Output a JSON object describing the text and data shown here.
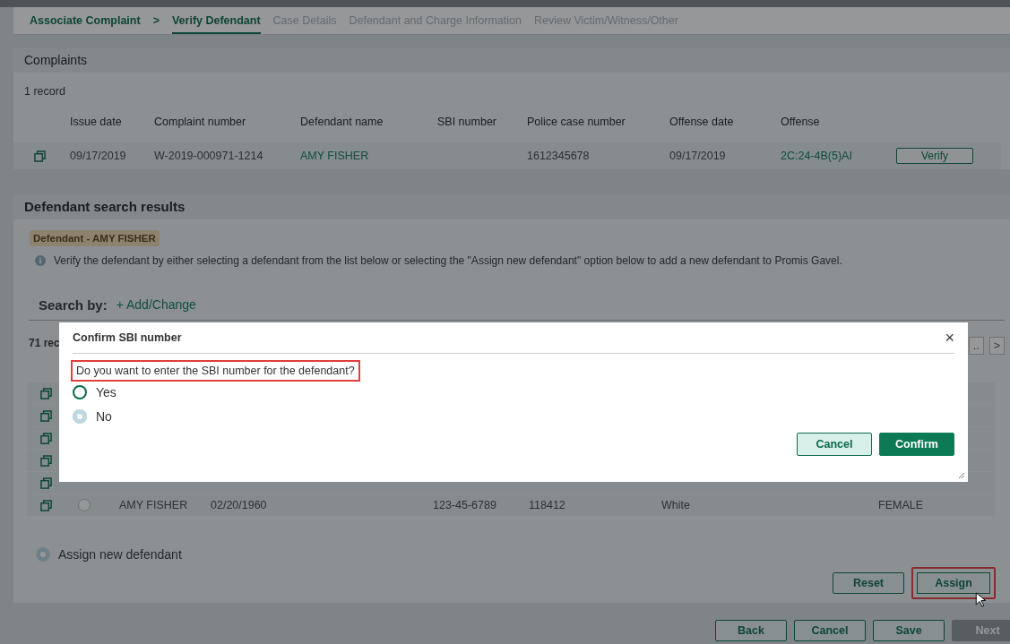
{
  "tabs": [
    {
      "label": "Associate Complaint",
      "selected": false,
      "enabled": true
    },
    {
      "label": "Verify Defendant",
      "selected": true,
      "enabled": true
    },
    {
      "label": "Case Details",
      "selected": false,
      "enabled": false
    },
    {
      "label": "Defendant and Charge Information",
      "selected": false,
      "enabled": false
    },
    {
      "label": "Review Victim/Witness/Other",
      "selected": false,
      "enabled": false
    }
  ],
  "tab_separator": ">",
  "complaints": {
    "title": "Complaints",
    "record_count": "1 record",
    "columns": [
      "Issue date",
      "Complaint number",
      "Defendant name",
      "SBI number",
      "Police case number",
      "Offense date",
      "Offense"
    ],
    "rows": [
      {
        "cells": [
          "09/17/2019",
          "W-2019-000971-1214",
          "AMY FISHER",
          "",
          "1612345678",
          "09/17/2019",
          "2C:24-4B(5)AI"
        ],
        "action": "Verify"
      }
    ]
  },
  "defendant_search": {
    "title": "Defendant search results",
    "defendant_tag": "Defendant - AMY FISHER",
    "info": "Verify the defendant by either selecting a defendant from the list below or selecting the \"Assign new defendant\" option below to add a new defendant to Promis Gavel.",
    "search_by_label": "Search by:",
    "add_change": "+ Add/Change",
    "record_count": "71 rec",
    "pager": [
      "..",
      ">"
    ],
    "rows": [
      {
        "selected": false,
        "cells": [
          "AMY FISHER",
          "02/20/1960",
          "123-45-6789",
          "118412",
          "White",
          "FEMALE"
        ]
      }
    ],
    "assign_new": {
      "label": "Assign new defendant",
      "selected": true
    },
    "buttons": [
      {
        "label": "Reset",
        "highlighted": false
      },
      {
        "label": "Assign",
        "highlighted": true
      }
    ]
  },
  "nav_buttons": [
    {
      "label": "Back",
      "disabled": false
    },
    {
      "label": "Cancel",
      "disabled": false
    },
    {
      "label": "Save",
      "disabled": false
    },
    {
      "label": "Next",
      "disabled": true
    }
  ],
  "dialog": {
    "title": "Confirm SBI number",
    "close": "×",
    "question": "Do you want to enter the SBI number for the defendant?",
    "question_highlighted": true,
    "options": [
      {
        "label": "Yes",
        "selected": false
      },
      {
        "label": "No",
        "selected": true
      }
    ],
    "buttons": [
      {
        "label": "Cancel",
        "kind": "secondary"
      },
      {
        "label": "Confirm",
        "kind": "primary"
      }
    ]
  }
}
